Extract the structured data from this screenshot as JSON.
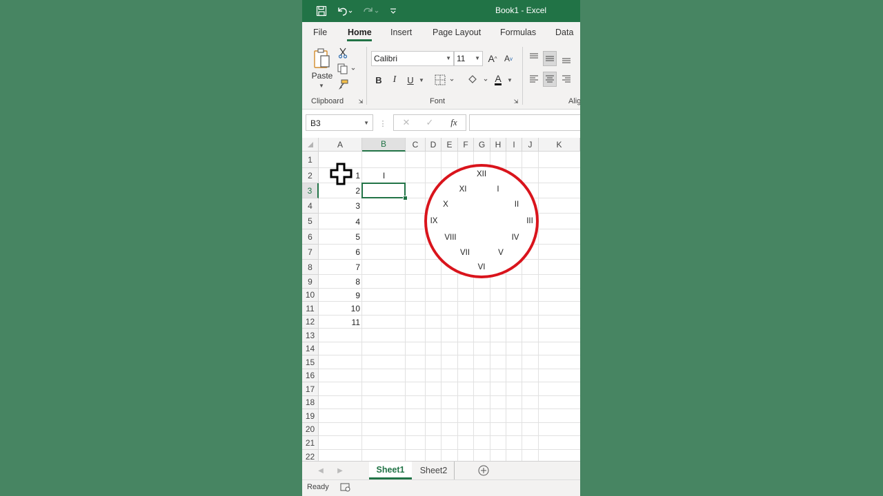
{
  "window": {
    "title": "Book1  -  Excel"
  },
  "qat": {
    "save_icon": "save-icon",
    "undo_icon": "undo-icon",
    "redo_icon": "redo-icon",
    "customize_icon": "customize-qat-icon"
  },
  "ribbon_tabs": [
    "File",
    "Home",
    "Insert",
    "Page Layout",
    "Formulas",
    "Data"
  ],
  "ribbon": {
    "clipboard": {
      "paste_label": "Paste",
      "group_label": "Clipboard"
    },
    "font": {
      "name": "Calibri",
      "size": "11",
      "bold": "B",
      "italic": "I",
      "underline": "U",
      "grow": "A",
      "shrink": "A",
      "font_color": "A",
      "group_label": "Font"
    },
    "alignment": {
      "group_label": "Alig"
    }
  },
  "formula_bar": {
    "name_box": "B3",
    "fx": "fx",
    "value": ""
  },
  "columns": [
    "A",
    "B",
    "C",
    "D",
    "E",
    "F",
    "G",
    "H",
    "I",
    "J",
    "K"
  ],
  "rows": [
    "1",
    "2",
    "3",
    "4",
    "5",
    "6",
    "7",
    "8",
    "9",
    "10",
    "11",
    "12",
    "13",
    "14",
    "15",
    "16",
    "17",
    "18",
    "19",
    "20",
    "21",
    "22"
  ],
  "cells": {
    "A": [
      "",
      "1",
      "2",
      "3",
      "4",
      "5",
      "6",
      "7",
      "8",
      "9",
      "10",
      "11"
    ],
    "B2": "I"
  },
  "selected_cell": "B3",
  "clock": {
    "border_color": "#d9141c",
    "numerals": [
      "XII",
      "I",
      "II",
      "III",
      "IV",
      "V",
      "VI",
      "VII",
      "VIII",
      "IX",
      "X",
      "XI"
    ]
  },
  "sheets": [
    "Sheet1",
    "Sheet2"
  ],
  "active_sheet": "Sheet1",
  "status": {
    "text": "Ready"
  },
  "colors": {
    "accent": "#217346",
    "background": "#478562"
  }
}
